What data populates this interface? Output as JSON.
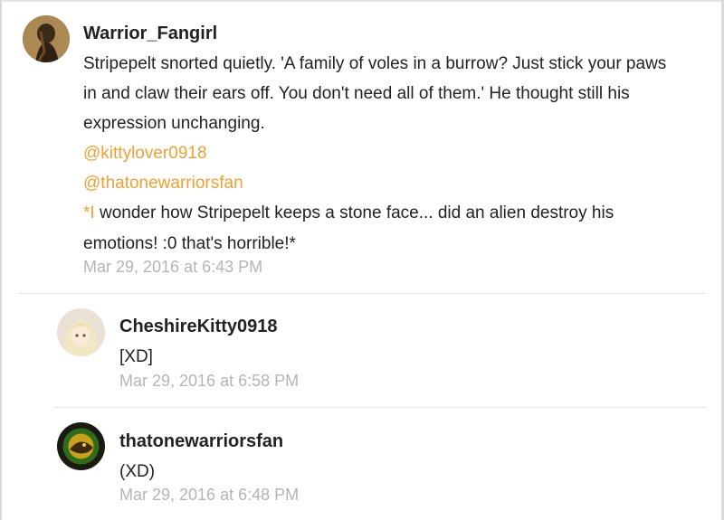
{
  "comments": [
    {
      "username": "Warrior_Fangirl",
      "lines": [
        "Stripepelt snorted quietly. 'A family of voles in a burrow? Just stick your paws",
        "in and claw their ears off. You don't need all of them.' He thought still his",
        "expression unchanging."
      ],
      "mentions": [
        "@kittylover0918",
        "@thatonewarriorsfan"
      ],
      "ooc_prefix": "*I",
      "ooc_lines": [
        " wonder how Stripepelt keeps a stone face... did an alien destroy his",
        "emotions! :0 that's horrible!"
      ],
      "ooc_suffix": "*",
      "timestamp": "Mar 29, 2016 at 6:43 PM",
      "avatar": "avatar-warrior-fangirl"
    },
    {
      "username": "CheshireKitty0918",
      "text": "[XD]",
      "timestamp": "Mar 29, 2016 at 6:58 PM",
      "avatar": "avatar-cheshirekitty"
    },
    {
      "username": "thatonewarriorsfan",
      "text": "(XD)",
      "timestamp": "Mar 29, 2016 at 6:48 PM",
      "avatar": "avatar-thatonewarriorsfan"
    }
  ],
  "colors": {
    "mention": "#f0a033",
    "timestamp": "#b5b5b5",
    "text": "#222222"
  }
}
